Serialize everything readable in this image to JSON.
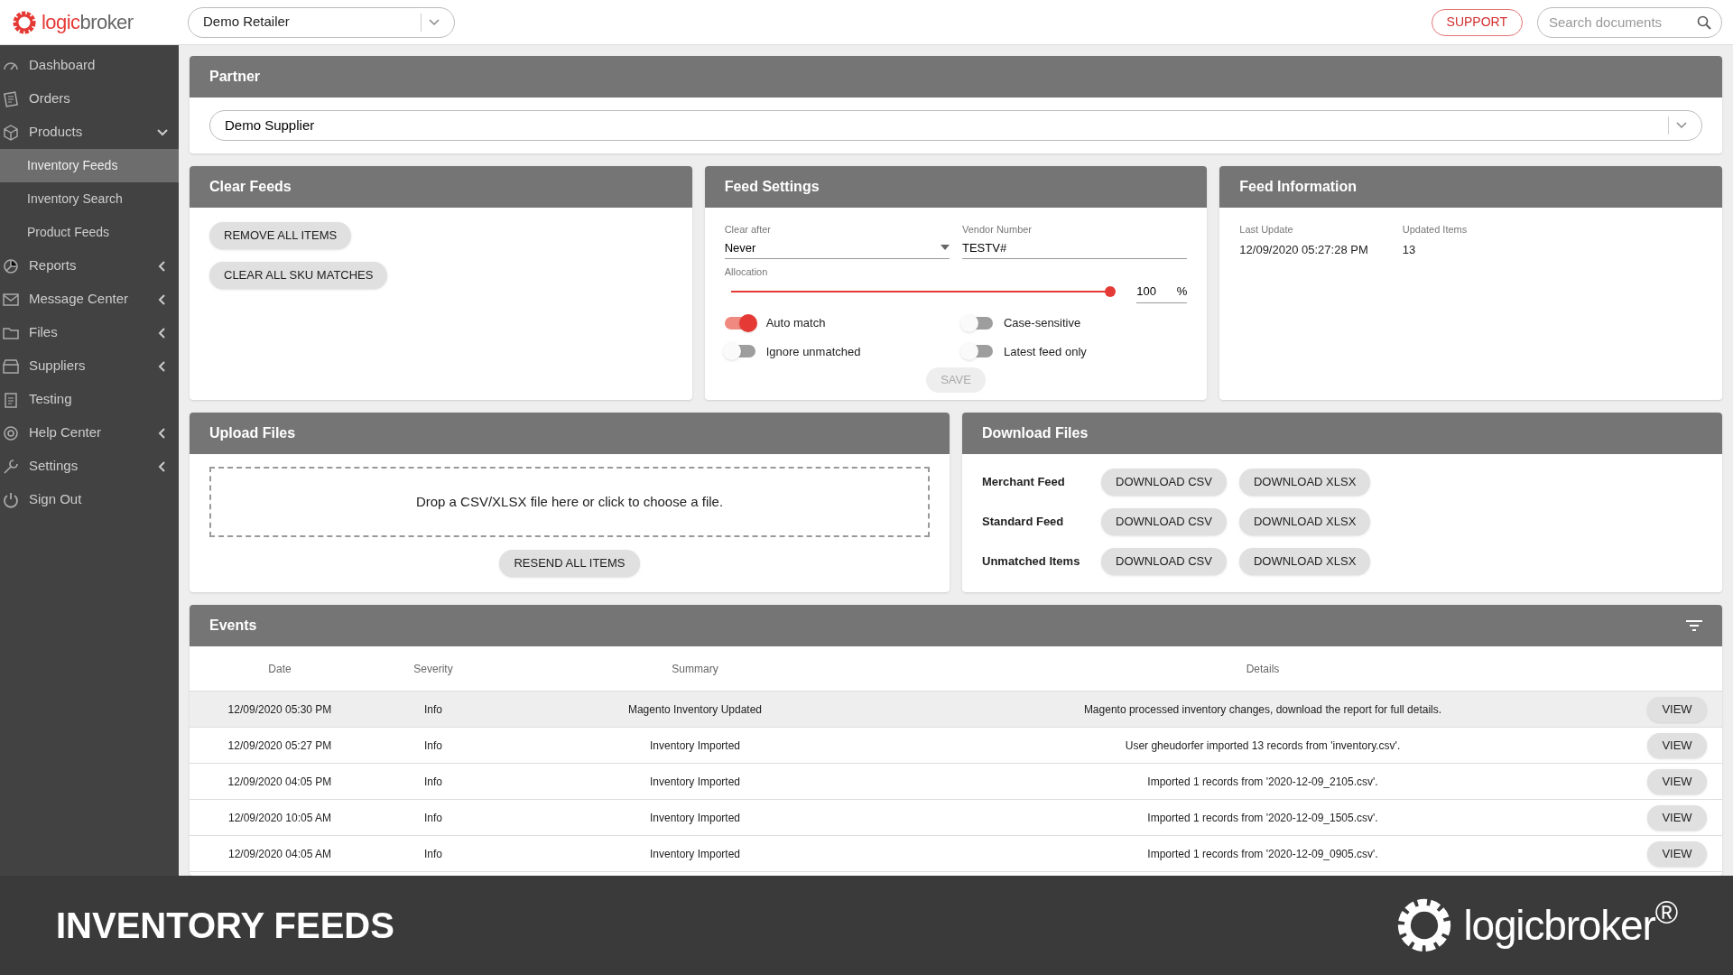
{
  "header": {
    "logo": {
      "part_a": "logic",
      "part_b": "broker"
    },
    "retailer_select": {
      "value": "Demo Retailer"
    },
    "support_button": "SUPPORT",
    "search": {
      "placeholder": "Search documents"
    }
  },
  "sidebar": {
    "items": [
      {
        "label": "Dashboard",
        "selected": false
      },
      {
        "label": "Orders",
        "selected": false
      },
      {
        "label": "Products",
        "expandable": true,
        "expanded": true,
        "selected": false,
        "children": [
          {
            "label": "Inventory Feeds",
            "selected": true
          },
          {
            "label": "Inventory Search",
            "selected": false
          },
          {
            "label": "Product Feeds",
            "selected": false
          }
        ]
      },
      {
        "label": "Reports",
        "expandable": true,
        "expanded": false,
        "selected": false
      },
      {
        "label": "Message Center",
        "expandable": true,
        "expanded": false,
        "selected": false
      },
      {
        "label": "Files",
        "expandable": true,
        "expanded": false,
        "selected": false
      },
      {
        "label": "Suppliers",
        "expandable": true,
        "expanded": false,
        "selected": false
      },
      {
        "label": "Testing",
        "selected": false
      },
      {
        "label": "Help Center",
        "expandable": true,
        "expanded": false,
        "selected": false
      },
      {
        "label": "Settings",
        "expandable": true,
        "expanded": false,
        "selected": false
      },
      {
        "label": "Sign Out",
        "selected": false
      }
    ]
  },
  "partner": {
    "title": "Partner",
    "select_value": "Demo Supplier"
  },
  "clear_feeds": {
    "title": "Clear Feeds",
    "buttons": [
      "REMOVE ALL ITEMS",
      "CLEAR ALL SKU MATCHES"
    ]
  },
  "feed_settings": {
    "title": "Feed Settings",
    "clear_after": {
      "label": "Clear after",
      "value": "Never"
    },
    "vendor_number": {
      "label": "Vendor Number",
      "value": "TESTV#"
    },
    "allocation": {
      "label": "Allocation",
      "level": 1.0,
      "value": "100",
      "unit": "%"
    },
    "toggles": [
      {
        "label": "Auto match",
        "on": true
      },
      {
        "label": "Case-sensitive",
        "on": false
      },
      {
        "label": "Ignore unmatched",
        "on": false
      },
      {
        "label": "Latest feed only",
        "on": false
      }
    ],
    "save_button": {
      "label": "SAVE",
      "disabled": true
    }
  },
  "feed_information": {
    "title": "Feed Information",
    "items": [
      {
        "label": "Last Update",
        "value": "12/09/2020 05:27:28 PM"
      },
      {
        "label": "Updated Items",
        "value": "13"
      }
    ]
  },
  "upload_files": {
    "title": "Upload Files",
    "dropzone_text": "Drop a CSV/XLSX file here or click to choose a file.",
    "resend_button": "RESEND ALL ITEMS"
  },
  "download_files": {
    "title": "Download Files",
    "rows": [
      {
        "label": "Merchant Feed",
        "buttons": [
          "DOWNLOAD CSV",
          "DOWNLOAD XLSX"
        ]
      },
      {
        "label": "Standard Feed",
        "buttons": [
          "DOWNLOAD CSV",
          "DOWNLOAD XLSX"
        ]
      },
      {
        "label": "Unmatched Items",
        "buttons": [
          "DOWNLOAD CSV",
          "DOWNLOAD XLSX"
        ]
      }
    ]
  },
  "events": {
    "title": "Events",
    "columns": [
      "Date",
      "Severity",
      "Summary",
      "Details"
    ],
    "rows": [
      {
        "date": "12/09/2020 05:30 PM",
        "severity": "Info",
        "summary": "Magento Inventory Updated",
        "details": "Magento processed inventory changes, download the report for full details.",
        "action": "VIEW",
        "selected": true
      },
      {
        "date": "12/09/2020 05:27 PM",
        "severity": "Info",
        "summary": "Inventory Imported",
        "details": "User gheudorfer imported 13 records from 'inventory.csv'.",
        "action": "VIEW",
        "selected": false
      },
      {
        "date": "12/09/2020 04:05 PM",
        "severity": "Info",
        "summary": "Inventory Imported",
        "details": "Imported 1 records from '2020-12-09_2105.csv'.",
        "action": "VIEW",
        "selected": false
      },
      {
        "date": "12/09/2020 10:05 AM",
        "severity": "Info",
        "summary": "Inventory Imported",
        "details": "Imported 1 records from '2020-12-09_1505.csv'.",
        "action": "VIEW",
        "selected": false
      },
      {
        "date": "12/09/2020 04:05 AM",
        "severity": "Info",
        "summary": "Inventory Imported",
        "details": "Imported 1 records from '2020-12-09_0905.csv'.",
        "action": "VIEW",
        "selected": false
      }
    ]
  },
  "caption_banner": {
    "title": "INVENTORY FEEDS",
    "logo": "logicbroker$^{®}$"
  }
}
